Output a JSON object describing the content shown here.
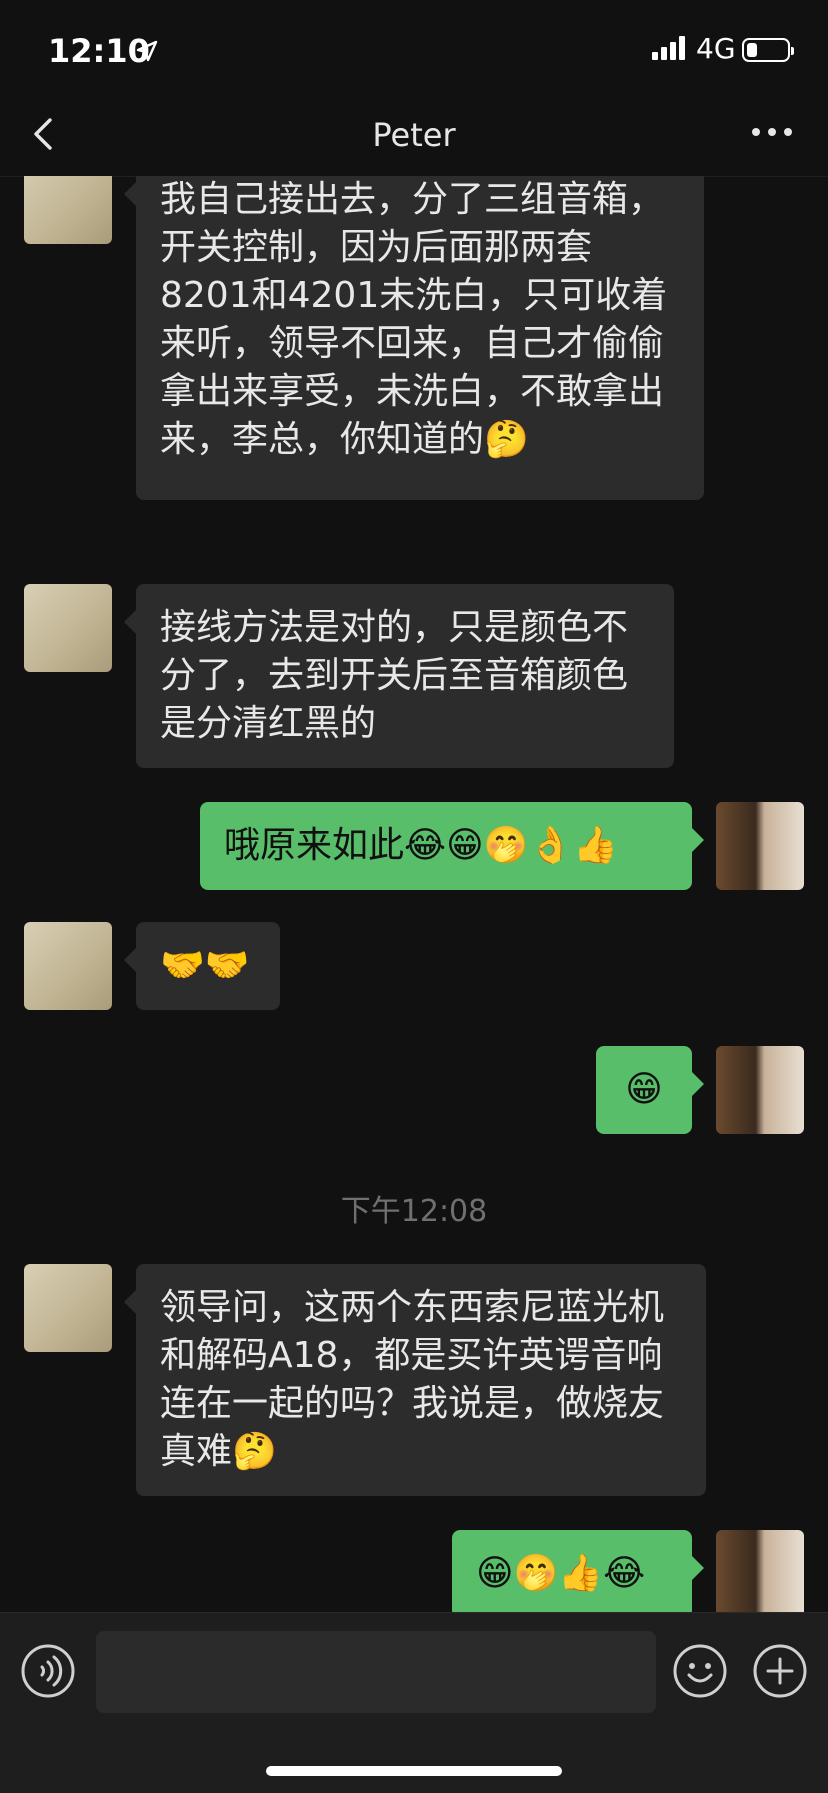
{
  "status_bar": {
    "time": "12:10",
    "network": "4G",
    "battery_level": 0.25,
    "icons": [
      "location-arrow-icon",
      "signal-icon",
      "battery-icon"
    ]
  },
  "header": {
    "title": "Peter",
    "back_icon": "chevron-left-icon",
    "more_icon": "ellipsis-icon"
  },
  "messages": [
    {
      "side": "left",
      "avatar": "flower-painting-avatar",
      "text": "我自己接出去，分了三组音箱，开关控制，因为后面那两套8201和4201未洗白，只可收着来听，领导不回来，自己才偷偷拿出来享受，未洗白，不敢拿出来，李总，你知道的🤔"
    },
    {
      "side": "left",
      "avatar": "flower-painting-avatar",
      "text": "接线方法是对的，只是颜色不分了，去到开关后至音箱颜色是分清红黑的"
    },
    {
      "side": "right",
      "avatar": "two-people-photo-avatar",
      "text": "哦原来如此😂😁🤭👌👍"
    },
    {
      "side": "left",
      "avatar": "flower-painting-avatar",
      "text": "🤝🤝"
    },
    {
      "side": "right",
      "avatar": "two-people-photo-avatar",
      "text": "😁"
    },
    {
      "side": "left",
      "avatar": "flower-painting-avatar",
      "text": "领导问，这两个东西索尼蓝光机和解码A18，都是买许英谔音响连在一起的吗？我说是，做烧友真难🤔"
    },
    {
      "side": "right",
      "avatar": "two-people-photo-avatar",
      "text": "😁🤭👍😂"
    }
  ],
  "timestamp": "下午12:08",
  "input_bar": {
    "voice_icon": "voice-icon",
    "emoji_icon": "smiley-icon",
    "plus_icon": "plus-circle-icon",
    "text_value": ""
  },
  "colors": {
    "background": "#111111",
    "incoming_bubble": "#2c2c2c",
    "outgoing_bubble": "#58be6a"
  }
}
